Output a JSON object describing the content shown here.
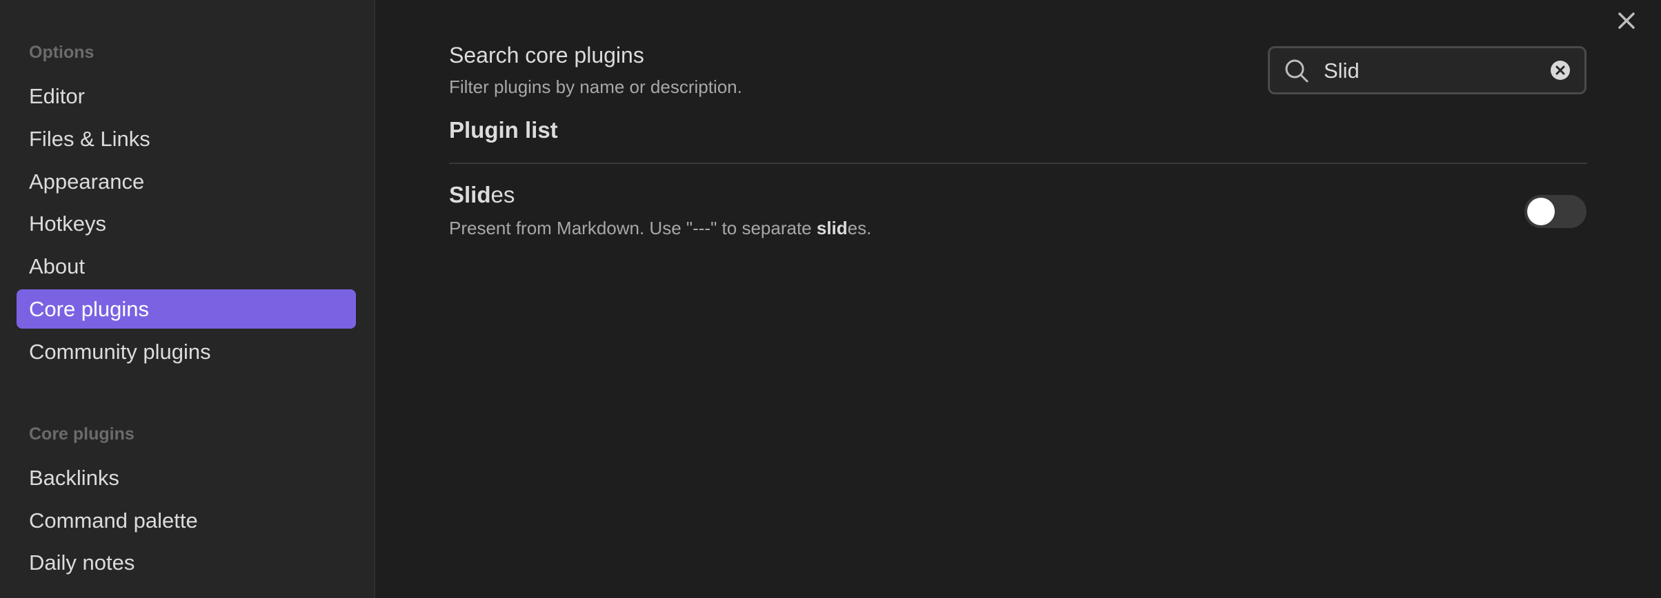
{
  "sidebar": {
    "options_heading": "Options",
    "options_items": [
      {
        "label": "Editor"
      },
      {
        "label": "Files & Links"
      },
      {
        "label": "Appearance"
      },
      {
        "label": "Hotkeys"
      },
      {
        "label": "About"
      },
      {
        "label": "Core plugins",
        "active": true
      },
      {
        "label": "Community plugins"
      }
    ],
    "core_heading": "Core plugins",
    "core_items": [
      {
        "label": "Backlinks"
      },
      {
        "label": "Command palette"
      },
      {
        "label": "Daily notes"
      }
    ]
  },
  "main": {
    "search_setting": {
      "name": "Search core plugins",
      "description": "Filter plugins by name or description.",
      "value": "Slid",
      "icon": "search-icon",
      "clear_icon": "clear-icon"
    },
    "plugin_list_heading": "Plugin list",
    "plugins": [
      {
        "name_match": "Slid",
        "name_rest": "es",
        "desc_before": "Present from Markdown. Use \"---\" to separate ",
        "desc_match": "slid",
        "desc_after": "es.",
        "enabled": false
      }
    ],
    "close_icon": "close-icon"
  },
  "colors": {
    "background": "#1e1e1e",
    "sidebar": "#262626",
    "accent": "#7b62e3",
    "text": "#dcdcdc",
    "muted": "#a8a8a8"
  }
}
